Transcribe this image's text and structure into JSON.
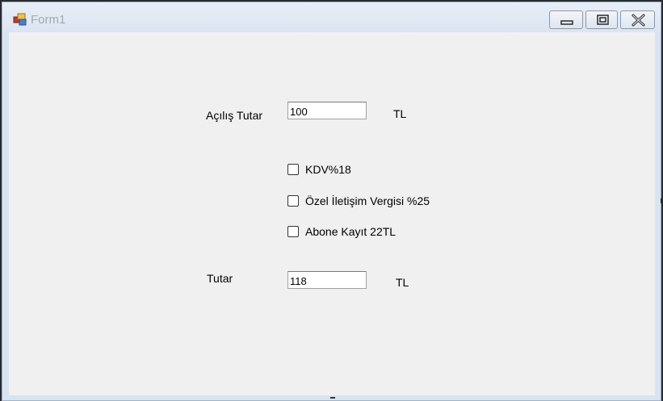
{
  "window": {
    "title": "Form1"
  },
  "form": {
    "opening_amount": {
      "label": "Açılış Tutar",
      "value": "100",
      "unit": "TL"
    },
    "checkboxes": [
      {
        "label": "KDV%18",
        "checked": false
      },
      {
        "label": "Özel İletişim Vergisi %25",
        "checked": false
      },
      {
        "label": "Abone Kayıt 22TL",
        "checked": false
      }
    ],
    "total_amount": {
      "label": "Tutar",
      "value": "118",
      "unit": "TL"
    }
  },
  "colors": {
    "titlebar": "#dbe5f1",
    "client_background": "#f0f0f0",
    "title_text": "#a3a9b3"
  },
  "icons": {
    "app": "form-app-icon",
    "minimize": "minimize-icon",
    "maximize": "maximize-icon",
    "close": "close-icon"
  }
}
